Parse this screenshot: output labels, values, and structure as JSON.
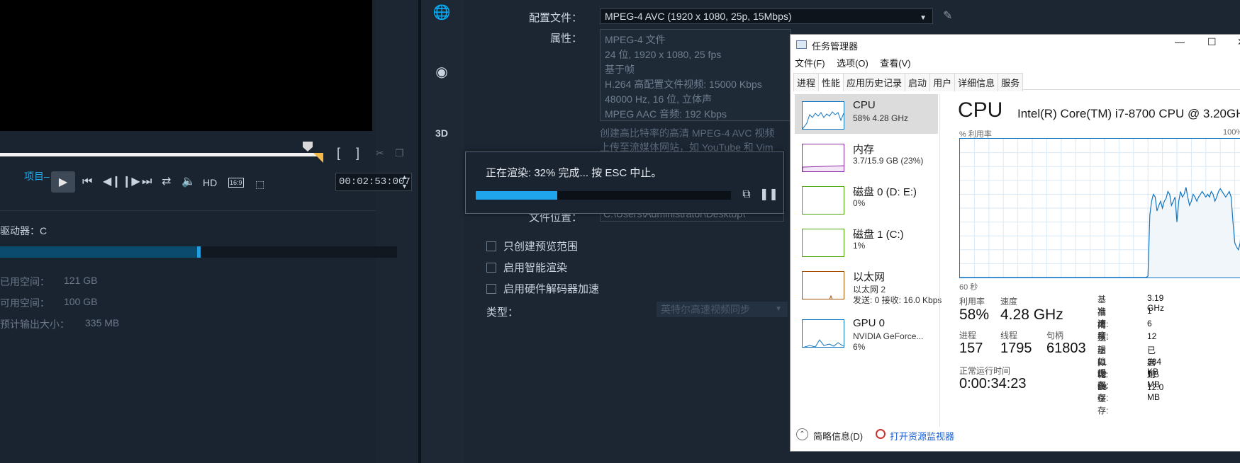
{
  "editor": {
    "project_mode": "项目",
    "quality": "HD",
    "aspect": "16:9",
    "timecode": "00:02:53:007",
    "icons": [
      "play-icon",
      "prev-icon",
      "step-back-icon",
      "step-forward-icon",
      "next-icon",
      "repeat-icon",
      "volume-icon"
    ],
    "drive": {
      "label": "驱动器：C",
      "used_label": "已用空间：",
      "used_value": "121 GB",
      "free_label": "可用空间：",
      "free_value": "100 GB",
      "output_label": "预计输出大小：",
      "output_value": "335 MB",
      "used_fraction": 0.5
    }
  },
  "settings": {
    "profile_label": "配置文件：",
    "profile_value": "MPEG-4 AVC (1920 x 1080, 25p, 15Mbps)",
    "props_label": "属性：",
    "props": [
      "MPEG-4 文件",
      "24 位, 1920 x 1080, 25 fps",
      "基于帧",
      "H.264 高配置文件视频: 15000 Kbps",
      "48000 Hz, 16 位, 立体声",
      "MPEG AAC 音频: 192 Kbps"
    ],
    "desc_line1": "创建高比特率的高清 MPEG-4 AVC 视频",
    "desc_line2": "上传至流媒体网站，如 YouTube 和 Vim",
    "file_location_label": "文件位置：",
    "file_location_value": "C:\\Users\\Administrator\\Desktop\\",
    "checkboxes": [
      "只创建预览范围",
      "启用智能渲染",
      "启用硬件解码器加速"
    ],
    "type_label": "类型：",
    "type_value": "英特尔高速视频同步"
  },
  "render": {
    "status": "正在渲染: 32% 完成... 按 ESC 中止。",
    "progress": 0.32
  },
  "taskmanager": {
    "title": "任务管理器",
    "menu": [
      "文件(F)",
      "选项(O)",
      "查看(V)"
    ],
    "tabs": [
      "进程",
      "性能",
      "应用历史记录",
      "启动",
      "用户",
      "详细信息",
      "服务"
    ],
    "active_tab": "性能",
    "items": [
      {
        "name": "CPU",
        "sub": "58% 4.28 GHz",
        "color": "#1174c0"
      },
      {
        "name": "内存",
        "sub": "3.7/15.9 GB (23%)",
        "color": "#8e2aa8"
      },
      {
        "name": "磁盘 0 (D: E:)",
        "sub": "0%",
        "color": "#4da60c"
      },
      {
        "name": "磁盘 1 (C:)",
        "sub": "1%",
        "color": "#4da60c"
      },
      {
        "name": "以太网",
        "sub": "以太网 2",
        "sub2": "发送: 0 接收: 16.0 Kbps",
        "color": "#a74f01"
      },
      {
        "name": "GPU 0",
        "sub": "NVIDIA GeForce...",
        "sub2": "6%",
        "color": "#1174c0"
      }
    ],
    "cpu": {
      "heading": "CPU",
      "model": "Intel(R) Core(TM) i7-8700 CPU @ 3.20GHz",
      "util_axis_label": "% 利用率",
      "util_axis_max": "100%",
      "time_label": "60 秒",
      "util_label": "利用率",
      "util_value": "58%",
      "speed_label": "速度",
      "speed_value": "4.28 GHz",
      "proc_label": "进程",
      "proc_value": "157",
      "thread_label": "线程",
      "thread_value": "1795",
      "handle_label": "句柄",
      "handle_value": "61803",
      "uptime_label": "正常运行时间",
      "uptime_value": "0:00:34:23",
      "right": [
        [
          "基准速度:",
          "3.19 GHz"
        ],
        [
          "插槽:",
          "1"
        ],
        [
          "内核:",
          "6"
        ],
        [
          "逻辑处理器:",
          "12"
        ],
        [
          "虚拟化:",
          "已启用"
        ],
        [
          "L1 缓存:",
          "384 KB"
        ],
        [
          "L2 缓存:",
          "1.5 MB"
        ],
        [
          "L3 缓存:",
          "12.0 MB"
        ]
      ],
      "history": [
        0,
        0,
        0,
        0,
        0,
        0,
        0,
        0,
        0,
        0,
        0,
        0,
        0,
        0,
        0,
        0,
        0,
        0,
        0,
        0,
        0,
        0,
        0,
        0,
        0,
        0,
        0,
        0,
        0,
        0,
        0,
        0,
        0,
        0,
        0,
        0,
        0,
        0,
        0,
        0,
        0,
        0,
        0,
        0,
        0,
        0,
        0,
        0,
        0,
        0,
        0,
        0,
        0,
        0,
        0,
        0,
        0,
        0,
        0,
        0,
        0,
        0,
        0,
        0,
        0,
        0,
        0,
        0,
        0,
        0,
        0,
        0,
        0,
        0,
        0,
        0,
        0,
        0,
        0,
        0,
        0,
        0,
        0,
        0,
        0,
        0,
        0,
        0,
        0,
        0,
        0,
        0,
        0,
        0,
        0,
        0,
        0,
        0,
        0,
        0,
        0,
        0,
        0,
        0,
        1,
        45,
        55,
        60,
        58,
        48,
        52,
        55,
        50,
        55,
        57,
        62,
        60,
        52,
        55,
        58,
        40,
        55,
        62,
        58,
        60,
        65,
        58,
        52,
        55,
        60,
        58,
        55,
        58,
        60,
        62,
        60,
        58,
        60,
        58,
        62,
        60,
        55,
        58,
        62,
        64,
        62,
        60,
        58,
        60,
        62,
        58,
        40,
        25,
        22,
        20,
        25,
        55,
        62,
        65,
        60,
        58
      ]
    },
    "footer_fewer": "简略信息(D)",
    "footer_monitor": "打开资源监视器"
  }
}
